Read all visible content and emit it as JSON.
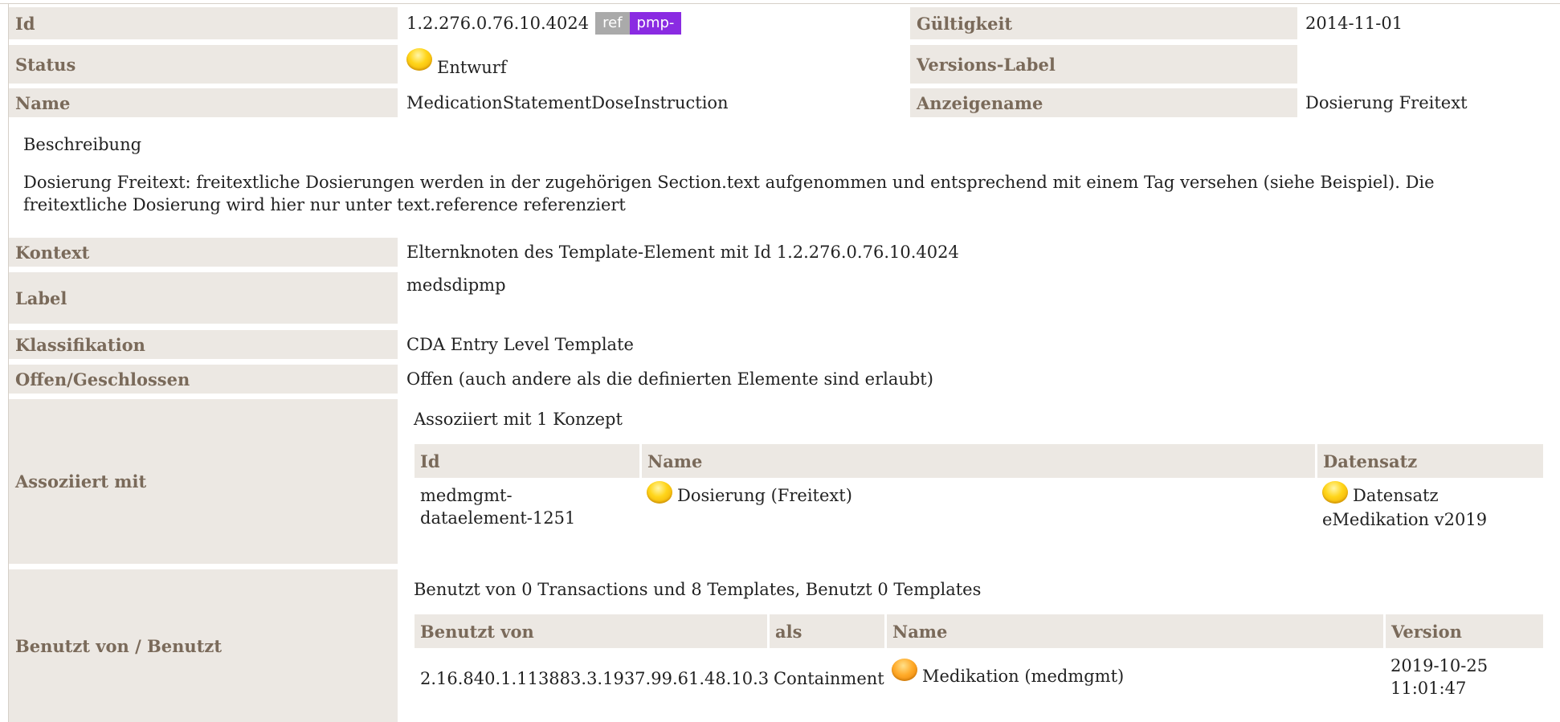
{
  "header": {
    "id_label": "Id",
    "id_value": "1.2.276.0.76.10.4024",
    "ref_tag": "ref",
    "pmp_tag": "pmp-",
    "validity_label": "Gültigkeit",
    "validity_value": "2014-11-01",
    "status_label": "Status",
    "status_value": "Entwurf",
    "version_label": "Versions-Label",
    "version_value": "",
    "name_label": "Name",
    "name_value": "MedicationStatementDoseInstruction",
    "display_label": "Anzeigename",
    "display_value": "Dosierung Freitext"
  },
  "description": {
    "heading": "Beschreibung",
    "text": "Dosierung Freitext: freitextliche Dosierungen werden in der zugehörigen Section.text aufgenommen und entsprechend mit einem Tag versehen (siehe Beispiel). Die freitextliche Dosierung wird hier nur unter text.reference referenziert"
  },
  "details": {
    "context_label": "Kontext",
    "context_value": "Elternknoten des Template-Element mit Id 1.2.276.0.76.10.4024",
    "label_label": "Label",
    "label_value": "medsdipmp",
    "class_label": "Klassifikation",
    "class_value": "CDA Entry Level Template",
    "open_label": "Offen/Geschlossen",
    "open_value": "Offen (auch andere als die definierten Elemente sind erlaubt)"
  },
  "associated": {
    "label": "Assoziiert mit",
    "summary": "Assoziiert mit 1 Konzept",
    "columns": [
      "Id",
      "Name",
      "Datensatz"
    ],
    "rows": [
      {
        "id": "medmgmt-dataelement-1251",
        "name": "Dosierung (Freitext)",
        "dataset": "Datensatz eMedikation v2019"
      }
    ]
  },
  "usage": {
    "label": "Benutzt von / Benutzt",
    "summary": "Benutzt von 0 Transactions und 8 Templates, Benutzt 0 Templates",
    "columns": [
      "Benutzt von",
      "als",
      "Name",
      "Version"
    ],
    "rows": [
      {
        "used_by": "2.16.840.1.113883.3.1937.99.61.48.10.3",
        "as": "Containment",
        "name": "Medikation (medmgmt)",
        "version": "2019-10-25 11:01:47"
      }
    ]
  },
  "colors": {
    "label_bg": "#ece8e3",
    "label_text": "#7a6a5a",
    "ref_tag": "#aaaaaa",
    "pmp_tag": "#8a2be2",
    "status_draft": "#ffd51a",
    "status_active": "#ffab2a"
  },
  "icons": {
    "status": "yellow-ball-icon",
    "active": "orange-ball-icon"
  }
}
